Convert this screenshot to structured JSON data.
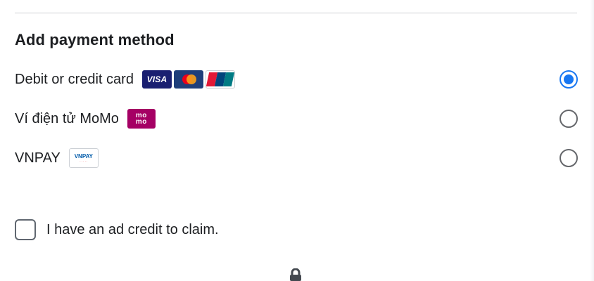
{
  "section": {
    "title": "Add payment method"
  },
  "payment_options": [
    {
      "label": "Debit or credit card",
      "selected": true,
      "logos": [
        {
          "name": "visa",
          "text": "VISA"
        },
        {
          "name": "mastercard",
          "text": ""
        },
        {
          "name": "unionpay",
          "text": "UnionPay"
        }
      ]
    },
    {
      "label": "Ví điện tử MoMo",
      "selected": false,
      "logos": [
        {
          "name": "momo",
          "text_top": "mo",
          "text_bottom": "mo"
        }
      ]
    },
    {
      "label": "VNPAY",
      "selected": false,
      "logos": [
        {
          "name": "vnpay",
          "text": "VNPAY"
        }
      ]
    }
  ],
  "ad_credit": {
    "label": "I have an ad credit to claim.",
    "checked": false
  },
  "colors": {
    "accent": "#1877f2",
    "text": "#1c1e21",
    "divider": "#ced0d4",
    "visa": "#1a1f71",
    "momo": "#a50064"
  }
}
